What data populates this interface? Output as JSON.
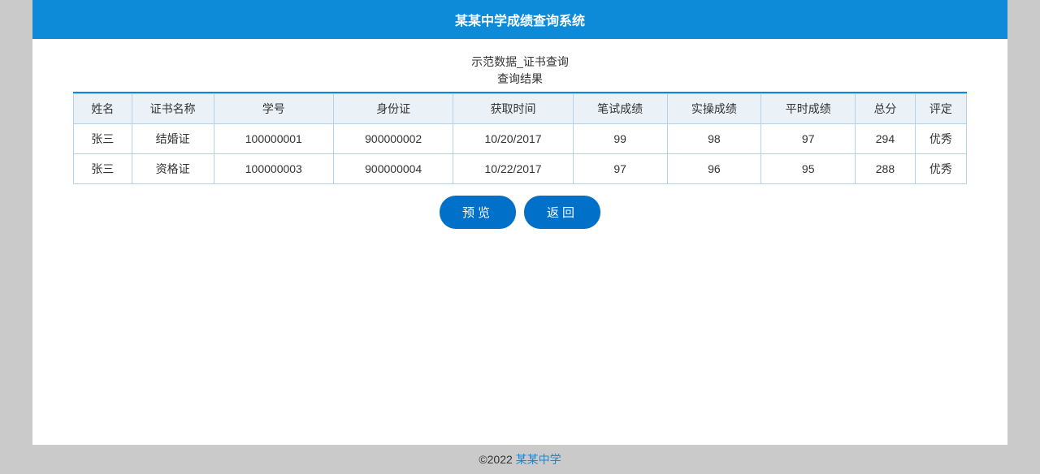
{
  "header": {
    "title": "某某中学成绩查询系统"
  },
  "page": {
    "subtitle_line1": "示范数据_证书查询",
    "subtitle_line2": "查询结果"
  },
  "table": {
    "headers": {
      "name": "姓名",
      "cert": "证书名称",
      "sid": "学号",
      "idcard": "身份证",
      "time": "获取时间",
      "written": "笔试成绩",
      "practical": "实操成绩",
      "usual": "平时成绩",
      "total": "总分",
      "eval": "评定"
    },
    "rows": [
      {
        "name": "张三",
        "cert": "结婚证",
        "sid": "100000001",
        "idcard": "900000002",
        "time": "10/20/2017",
        "written": "99",
        "practical": "98",
        "usual": "97",
        "total": "294",
        "eval": "优秀"
      },
      {
        "name": "张三",
        "cert": "资格证",
        "sid": "100000003",
        "idcard": "900000004",
        "time": "10/22/2017",
        "written": "97",
        "practical": "96",
        "usual": "95",
        "total": "288",
        "eval": "优秀"
      }
    ]
  },
  "buttons": {
    "preview": "预览",
    "back": "返回"
  },
  "footer": {
    "copyright": "©2022 ",
    "link": "某某中学"
  }
}
